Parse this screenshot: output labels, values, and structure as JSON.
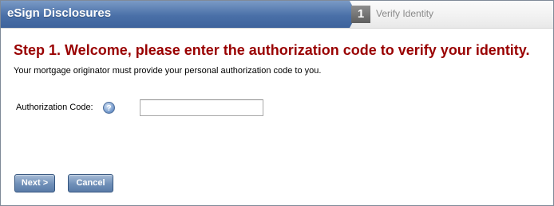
{
  "header": {
    "title": "eSign Disclosures",
    "step_number": "1",
    "step_label": "Verify Identity"
  },
  "main": {
    "heading": "Step 1. Welcome, please enter the authorization code to verify your identity.",
    "subtext": "Your mortgage originator must provide your personal authorization code to you.",
    "auth_code_label": "Authorization Code:",
    "help_glyph": "?",
    "auth_code_value": ""
  },
  "actions": {
    "next_label": "Next >",
    "cancel_label": "Cancel"
  },
  "colors": {
    "title_bar": "#4a70a8",
    "heading": "#990000",
    "button": "#6f8fb8"
  },
  "icons": {
    "help": "help-question-icon"
  }
}
